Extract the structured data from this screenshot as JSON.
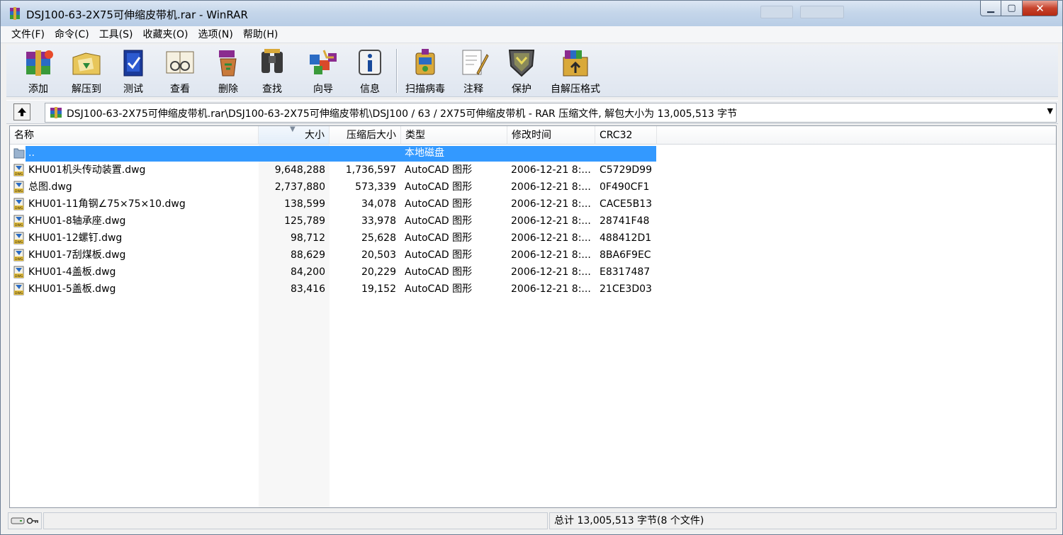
{
  "window": {
    "title": "DSJ100-63-2X75可伸缩皮带机.rar - WinRAR"
  },
  "menu": [
    "文件(F)",
    "命令(C)",
    "工具(S)",
    "收藏夹(O)",
    "选项(N)",
    "帮助(H)"
  ],
  "toolbar": {
    "buttons": [
      {
        "label": "添加",
        "icon": "add-archive-icon"
      },
      {
        "label": "解压到",
        "icon": "extract-to-icon"
      },
      {
        "label": "测试",
        "icon": "test-icon"
      },
      {
        "label": "查看",
        "icon": "view-icon"
      },
      {
        "label": "删除",
        "icon": "delete-icon"
      },
      {
        "label": "查找",
        "icon": "find-binoculars-icon"
      },
      {
        "label": "向导",
        "icon": "wizard-icon"
      },
      {
        "label": "信息",
        "icon": "info-icon"
      },
      {
        "label": "扫描病毒",
        "icon": "virus-scan-icon"
      },
      {
        "label": "注释",
        "icon": "comment-icon"
      },
      {
        "label": "保护",
        "icon": "protect-shield-icon"
      },
      {
        "label": "自解压格式",
        "icon": "sfx-icon"
      }
    ]
  },
  "address": {
    "path": "DSJ100-63-2X75可伸缩皮带机.rar\\DSJ100-63-2X75可伸缩皮带机\\DSJ100 / 63 / 2X75可伸缩皮带机 - RAR 压缩文件, 解包大小为 13,005,513 字节"
  },
  "columns": {
    "name": "名称",
    "size": "大小",
    "packed": "压缩后大小",
    "type": "类型",
    "modified": "修改时间",
    "crc": "CRC32"
  },
  "parent_row": {
    "name": "..",
    "type": "本地磁盘"
  },
  "files": [
    {
      "name": "KHU01机头传动装置.dwg",
      "size": "9,648,288",
      "packed": "1,736,597",
      "type": "AutoCAD 图形",
      "modified": "2006-12-21 8:...",
      "crc": "C5729D99"
    },
    {
      "name": "总图.dwg",
      "size": "2,737,880",
      "packed": "573,339",
      "type": "AutoCAD 图形",
      "modified": "2006-12-21 8:...",
      "crc": "0F490CF1"
    },
    {
      "name": "KHU01-11角钢∠75×75×10.dwg",
      "size": "138,599",
      "packed": "34,078",
      "type": "AutoCAD 图形",
      "modified": "2006-12-21 8:...",
      "crc": "CACE5B13"
    },
    {
      "name": "KHU01-8轴承座.dwg",
      "size": "125,789",
      "packed": "33,978",
      "type": "AutoCAD 图形",
      "modified": "2006-12-21 8:...",
      "crc": "28741F48"
    },
    {
      "name": "KHU01-12螺钉.dwg",
      "size": "98,712",
      "packed": "25,628",
      "type": "AutoCAD 图形",
      "modified": "2006-12-21 8:...",
      "crc": "488412D1"
    },
    {
      "name": "KHU01-7刮煤板.dwg",
      "size": "88,629",
      "packed": "20,503",
      "type": "AutoCAD 图形",
      "modified": "2006-12-21 8:...",
      "crc": "8BA6F9EC"
    },
    {
      "name": "KHU01-4盖板.dwg",
      "size": "84,200",
      "packed": "20,229",
      "type": "AutoCAD 图形",
      "modified": "2006-12-21 8:...",
      "crc": "E8317487"
    },
    {
      "name": "KHU01-5盖板.dwg",
      "size": "83,416",
      "packed": "19,152",
      "type": "AutoCAD 图形",
      "modified": "2006-12-21 8:...",
      "crc": "21CE3D03"
    }
  ],
  "status": {
    "summary": "总计 13,005,513 字节(8 个文件)"
  },
  "colors": {
    "selection": "#3399ff",
    "titlebar": "#c5d6ea"
  }
}
